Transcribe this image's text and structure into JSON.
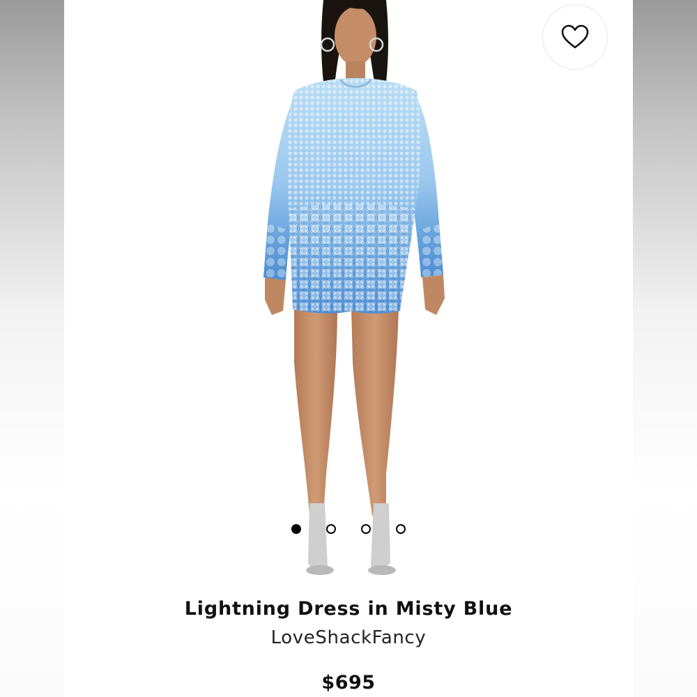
{
  "product": {
    "title": "Lightning Dress in Misty Blue",
    "brand": "LoveShackFancy",
    "price": "$695"
  },
  "favorite": {
    "icon": "heart-outline-icon"
  },
  "carousel": {
    "count": 4,
    "active_index": 0
  },
  "colors": {
    "dress_light": "#a9d2ef",
    "dress_dark": "#3f83cc",
    "skin": "#c08a66",
    "hair": "#1a1410"
  }
}
